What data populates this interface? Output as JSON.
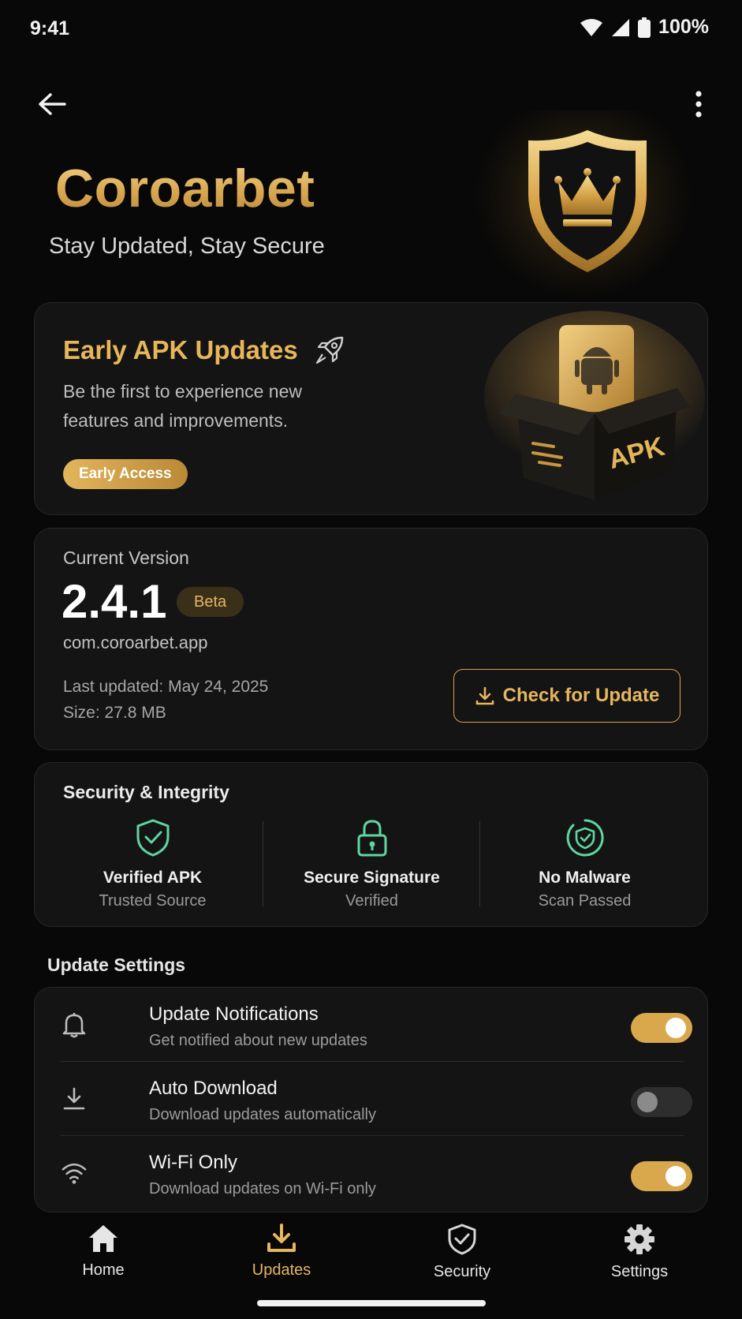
{
  "status_bar": {
    "time": "9:41",
    "battery": "100%"
  },
  "header": {
    "back_icon": "arrow-left-icon",
    "more_icon": "more-vert-icon"
  },
  "hero": {
    "brand": "Coroarbet",
    "tagline": "Stay Updated, Stay Secure",
    "emblem": "crown-shield-icon"
  },
  "early_card": {
    "title": "Early APK Updates",
    "title_icon": "rocket-icon",
    "description": "Be the first to experience new features and improvements.",
    "badge": "Early Access",
    "illustration_label": "APK"
  },
  "version_card": {
    "label": "Current Version",
    "version": "2.4.1",
    "channel": "Beta",
    "package": "com.coroarbet.app",
    "last_updated": "Last updated: May 24, 2025",
    "size": "Size: 27.8 MB",
    "check_button": "Check for Update"
  },
  "security": {
    "title": "Security & Integrity",
    "items": [
      {
        "name": "Verified APK",
        "sub": "Trusted Source",
        "icon": "shield-check-icon"
      },
      {
        "name": "Secure Signature",
        "sub": "Verified",
        "icon": "lock-icon"
      },
      {
        "name": "No Malware",
        "sub": "Scan Passed",
        "icon": "shield-scan-icon"
      }
    ]
  },
  "settings": {
    "heading": "Update Settings",
    "rows": [
      {
        "title": "Update Notifications",
        "subtitle": "Get notified about new updates",
        "icon": "bell-icon",
        "enabled": true
      },
      {
        "title": "Auto Download",
        "subtitle": "Download updates automatically",
        "icon": "download-icon",
        "enabled": false
      },
      {
        "title": "Wi-Fi Only",
        "subtitle": "Download updates on Wi-Fi only",
        "icon": "wifi-icon",
        "enabled": true
      }
    ]
  },
  "nav": {
    "items": [
      {
        "label": "Home",
        "icon": "home-icon"
      },
      {
        "label": "Updates",
        "icon": "download-icon",
        "active": true
      },
      {
        "label": "Security",
        "icon": "shield-check-icon"
      },
      {
        "label": "Settings",
        "icon": "gear-icon"
      }
    ]
  },
  "colors": {
    "accent": "#e6b65e",
    "success": "#5fd6a2",
    "background": "#080808",
    "card": "#141414"
  }
}
